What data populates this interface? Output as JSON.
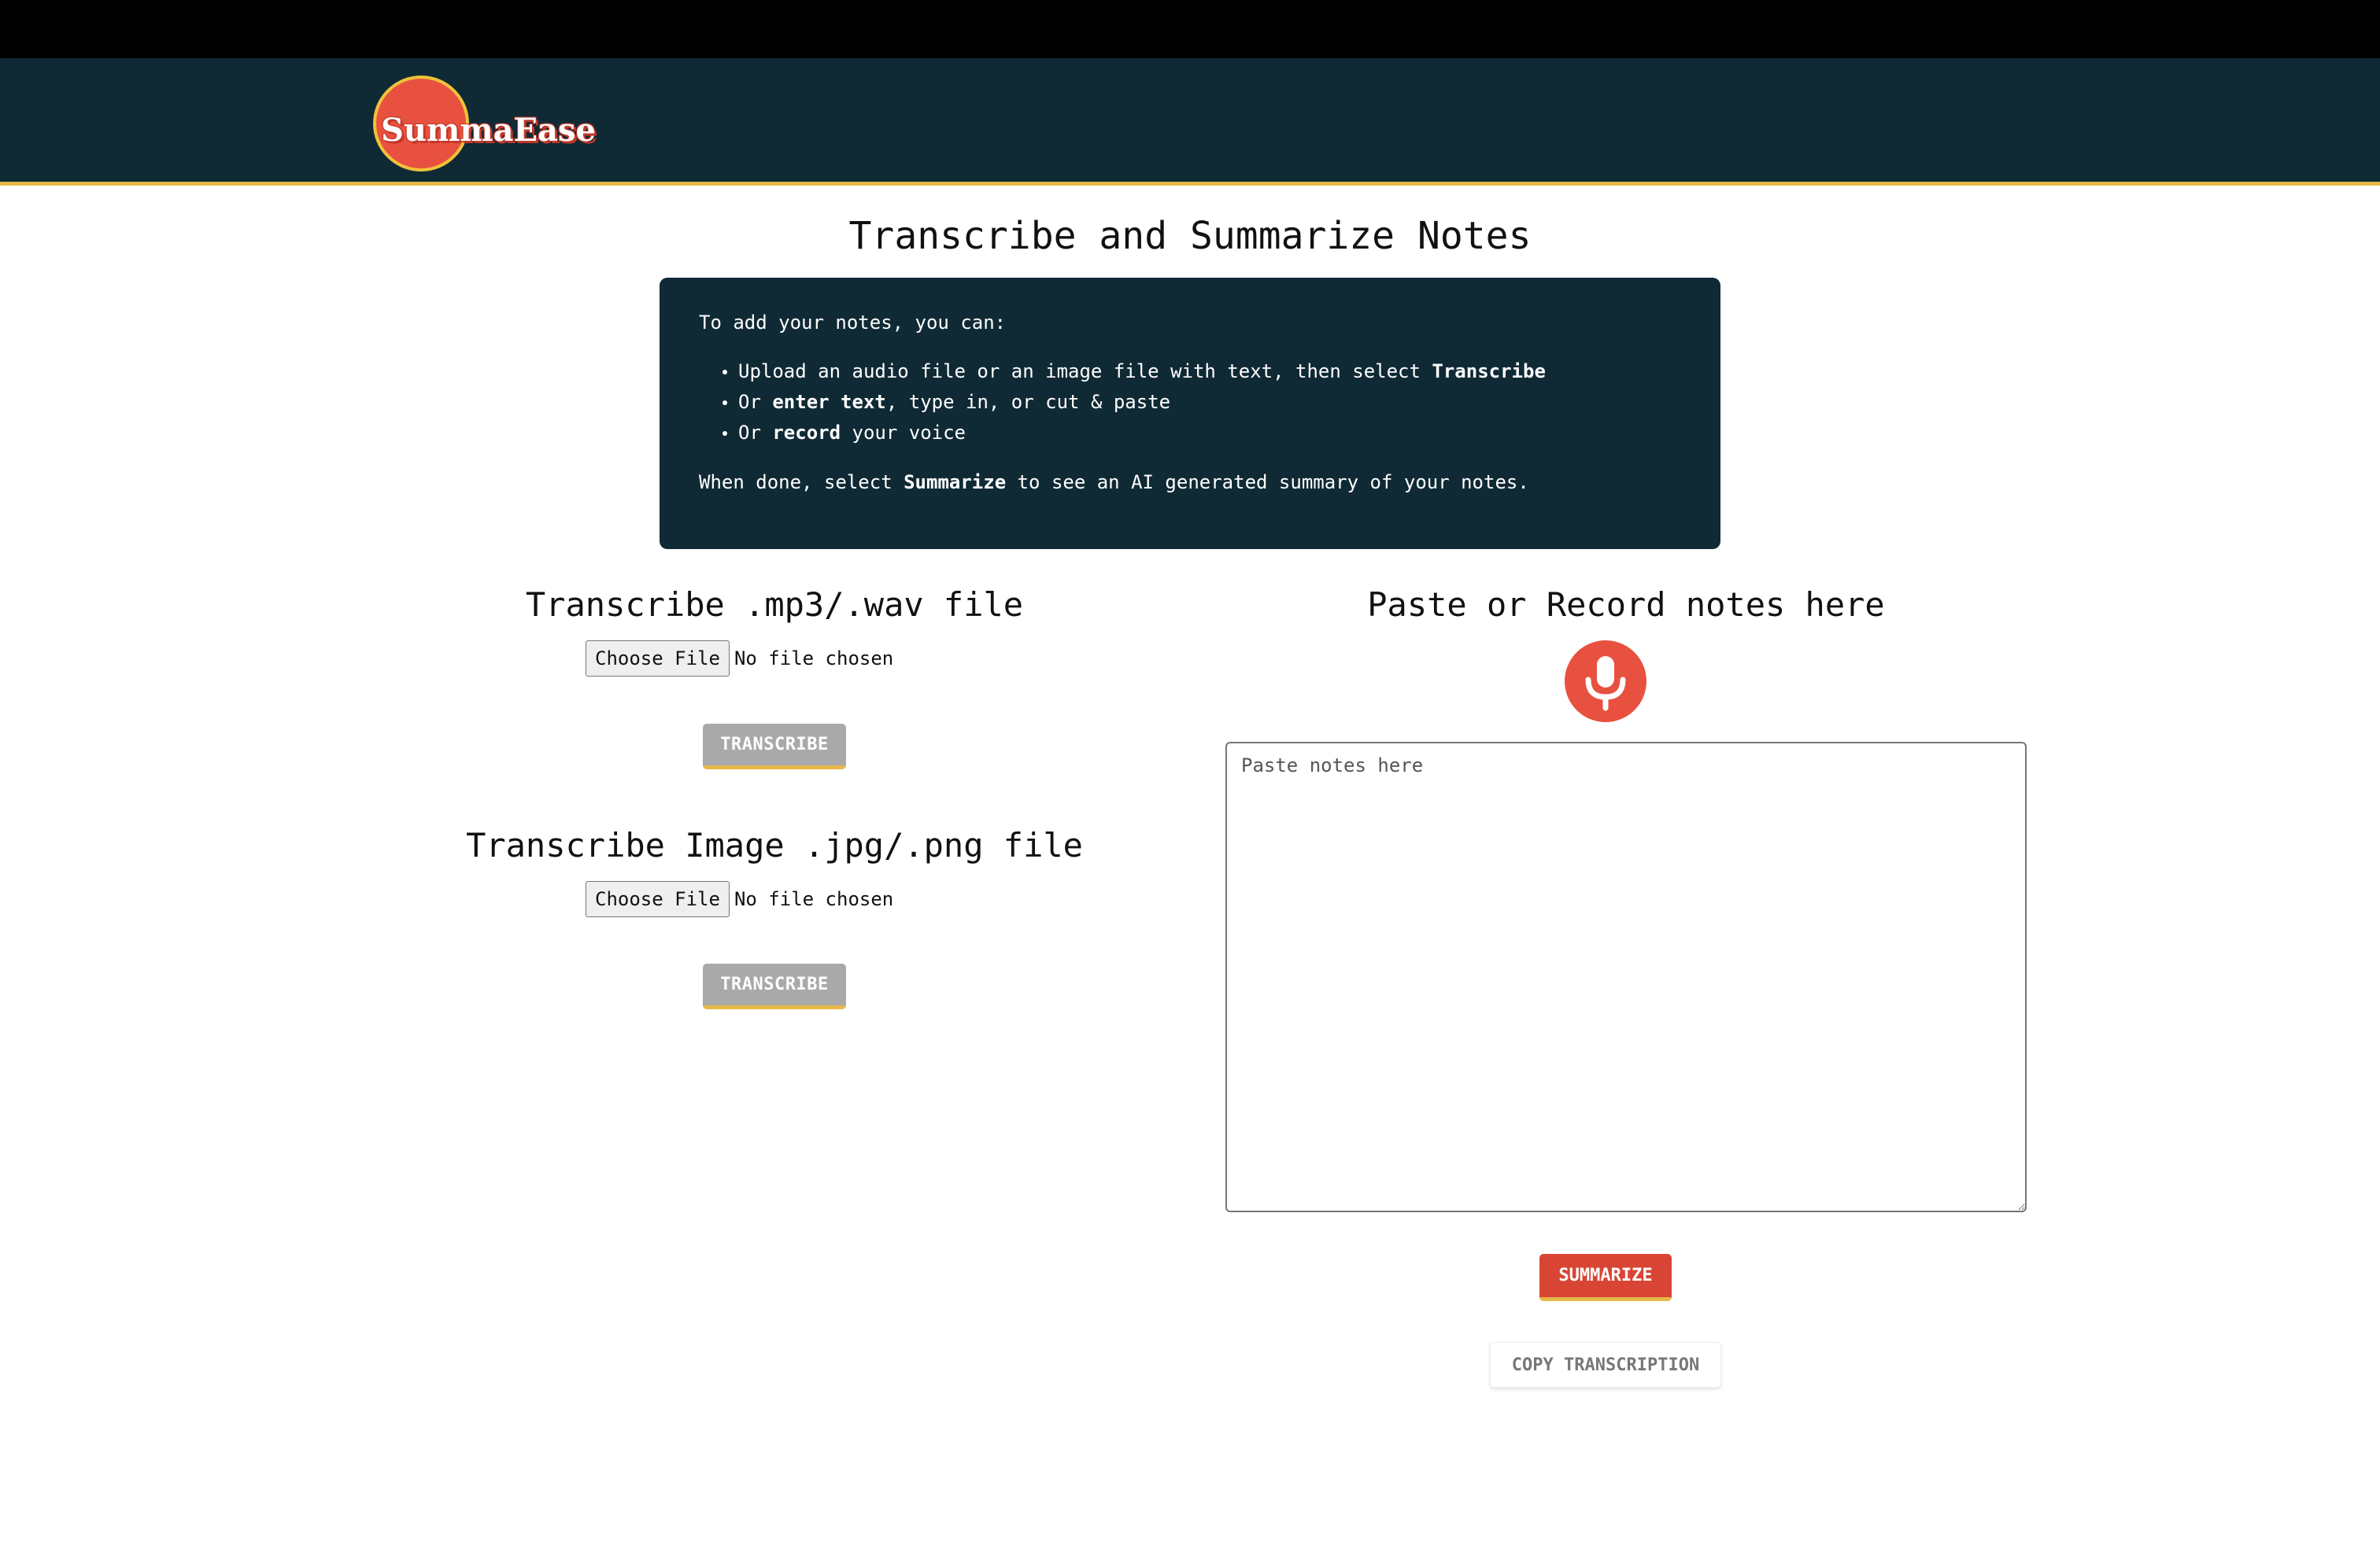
{
  "brand": {
    "logo_text": "SummaEase"
  },
  "page": {
    "title": "Transcribe and Summarize Notes"
  },
  "info": {
    "intro": "To add your notes, you can:",
    "item1_pre": "Upload an audio file or an image file with text, then select ",
    "item1_bold": "Transcribe",
    "item2_pre": "Or ",
    "item2_bold": "enter text",
    "item2_post": ", type in, or cut & paste",
    "item3_pre": "Or ",
    "item3_bold": "record",
    "item3_post": " your voice",
    "outro_pre": "When done, select ",
    "outro_bold": "Summarize",
    "outro_post": " to see an AI generated summary of your notes."
  },
  "audio": {
    "title": "Transcribe .mp3/.wav file",
    "choose_label": "Choose File",
    "status": "No file chosen",
    "button": "TRANSCRIBE"
  },
  "image": {
    "title": "Transcribe Image .jpg/.png file",
    "choose_label": "Choose File",
    "status": "No file chosen",
    "button": "TRANSCRIBE"
  },
  "notes": {
    "title": "Paste or Record notes here",
    "placeholder": "Paste notes here",
    "mic_icon": "microphone-icon",
    "summarize": "SUMMARIZE",
    "copy": "COPY TRANSCRIPTION"
  },
  "colors": {
    "header_bg": "#102a35",
    "accent_red": "#e8513f",
    "accent_yellow": "#e6b949",
    "disabled_gray": "#a9a9a9"
  }
}
